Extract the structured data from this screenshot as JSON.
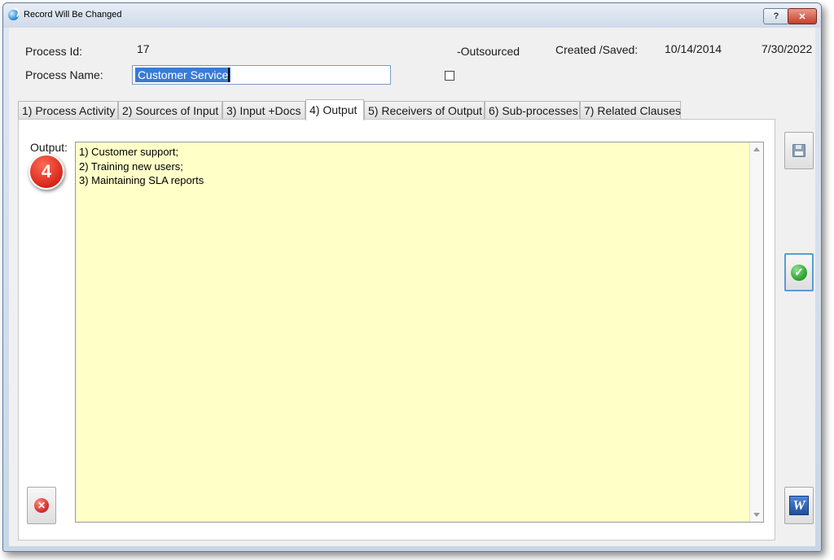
{
  "window": {
    "title": "Record Will Be Changed",
    "help_label": "?",
    "close_label": "✕"
  },
  "header": {
    "process_id_label": "Process Id:",
    "process_id_value": "17",
    "outsourced_label": "-Outsourced",
    "outsourced_checked": false,
    "created_saved_label": "Created /Saved:",
    "created_date": "10/14/2014",
    "saved_date": "7/30/2022",
    "process_name_label": "Process Name:",
    "process_name_value": "Customer Service"
  },
  "tabs": [
    {
      "label": "1) Process Activity",
      "active": false
    },
    {
      "label": "2) Sources of Input",
      "active": false
    },
    {
      "label": "3) Input +Docs",
      "active": false
    },
    {
      "label": "4) Output",
      "active": true
    },
    {
      "label": "5) Receivers of Output",
      "active": false
    },
    {
      "label": "6) Sub-processes",
      "active": false
    },
    {
      "label": "7) Related Clauses",
      "active": false
    }
  ],
  "output": {
    "label": "Output:",
    "lines": [
      "1) Customer support;",
      "2) Training new users;",
      "3) Maintaining SLA reports"
    ],
    "background": "#ffffc8"
  },
  "badge": {
    "number": "4",
    "color": "#d9261a"
  },
  "icons": {
    "save": "floppy-disk-icon",
    "confirm": "green-check-icon",
    "cancel": "red-x-icon",
    "export": "word-document-icon"
  },
  "word_icon_letter": "W",
  "check_glyph": "✓",
  "x_glyph": "✕"
}
